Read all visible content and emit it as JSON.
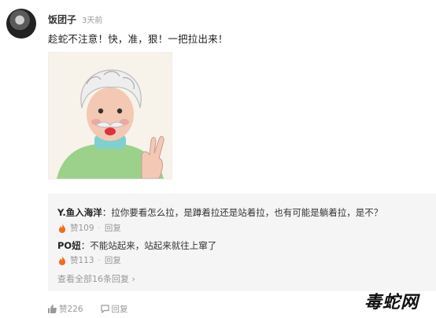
{
  "post": {
    "username": "饭团子",
    "time": "3天前",
    "text": "趁蛇不注意！快，准，狠！一把拉出来！"
  },
  "replies": [
    {
      "name": "Y.鱼入海洋",
      "text": "：拉你要看怎么拉，是蹲着拉还是站着拉，也有可能是躺着拉，是不？",
      "likes": "赞109",
      "reply_label": "回复"
    },
    {
      "name": "PO妞",
      "text": "：不能站起来，站起来就往上窜了",
      "likes": "赞113",
      "reply_label": "回复"
    }
  ],
  "view_all": "查看全部16条回复",
  "footer": {
    "likes": "赞226",
    "reply": "回复"
  },
  "watermark": "毒蛇网",
  "icons": [
    "avatar",
    "flame-icon",
    "thumbs-up-icon",
    "reply-icon",
    "chevron-right-icon"
  ],
  "colors": {
    "flame": "#f26b1d",
    "reply_bg": "#f5f5f5",
    "muted": "#999999"
  }
}
